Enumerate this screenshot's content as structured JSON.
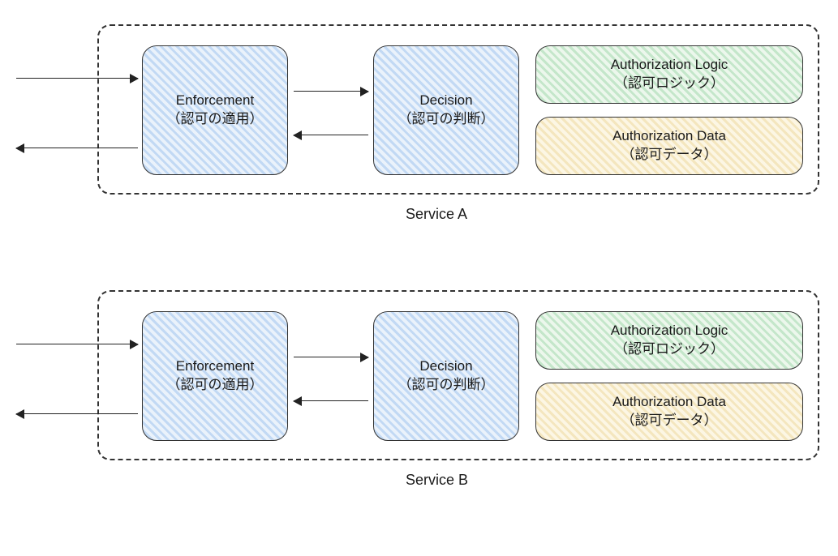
{
  "services": [
    {
      "label": "Service A",
      "enforcement": {
        "title": "Enforcement",
        "subtitle": "（認可の適用）"
      },
      "decision": {
        "title": "Decision",
        "subtitle": "（認可の判断）"
      },
      "logic": {
        "title": "Authorization Logic",
        "subtitle": "（認可ロジック）"
      },
      "data": {
        "title": "Authorization Data",
        "subtitle": "（認可データ）"
      }
    },
    {
      "label": "Service B",
      "enforcement": {
        "title": "Enforcement",
        "subtitle": "（認可の適用）"
      },
      "decision": {
        "title": "Decision",
        "subtitle": "（認可の判断）"
      },
      "logic": {
        "title": "Authorization Logic",
        "subtitle": "（認可ロジック）"
      },
      "data": {
        "title": "Authorization Data",
        "subtitle": "（認可データ）"
      }
    }
  ],
  "colors": {
    "blue": "#cfe2f6",
    "green": "#d8efd8",
    "yellow": "#f6ecc9",
    "stroke": "#333333"
  }
}
